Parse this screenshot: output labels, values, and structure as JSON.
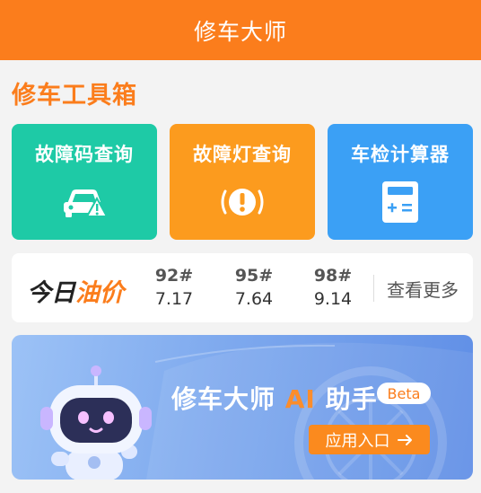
{
  "header": {
    "title": "修车大师"
  },
  "section": {
    "title": "修车工具箱"
  },
  "tools": [
    {
      "label": "故障码查询",
      "icon": "car-warning-icon",
      "color": "#1ecaa6"
    },
    {
      "label": "故障灯查询",
      "icon": "warning-light-icon",
      "color": "#fc9b1e"
    },
    {
      "label": "车检计算器",
      "icon": "calculator-icon",
      "color": "#3ba0f5"
    }
  ],
  "oil": {
    "title_part1": "今日",
    "title_part2": "油价",
    "prices": [
      {
        "grade": "92#",
        "price": "7.17"
      },
      {
        "grade": "95#",
        "price": "7.64"
      },
      {
        "grade": "98#",
        "price": "9.14"
      }
    ],
    "more": "查看更多"
  },
  "banner": {
    "title_part1": "修车大师 ",
    "title_ai": "AI",
    "title_part2": " 助手",
    "badge": "Beta",
    "button": "应用入口",
    "button_icon": "arrow-right-icon"
  },
  "colors": {
    "brand": "#fb7d1c",
    "green": "#1ecaa6",
    "amber": "#fc9b1e",
    "blue": "#3ba0f5"
  }
}
